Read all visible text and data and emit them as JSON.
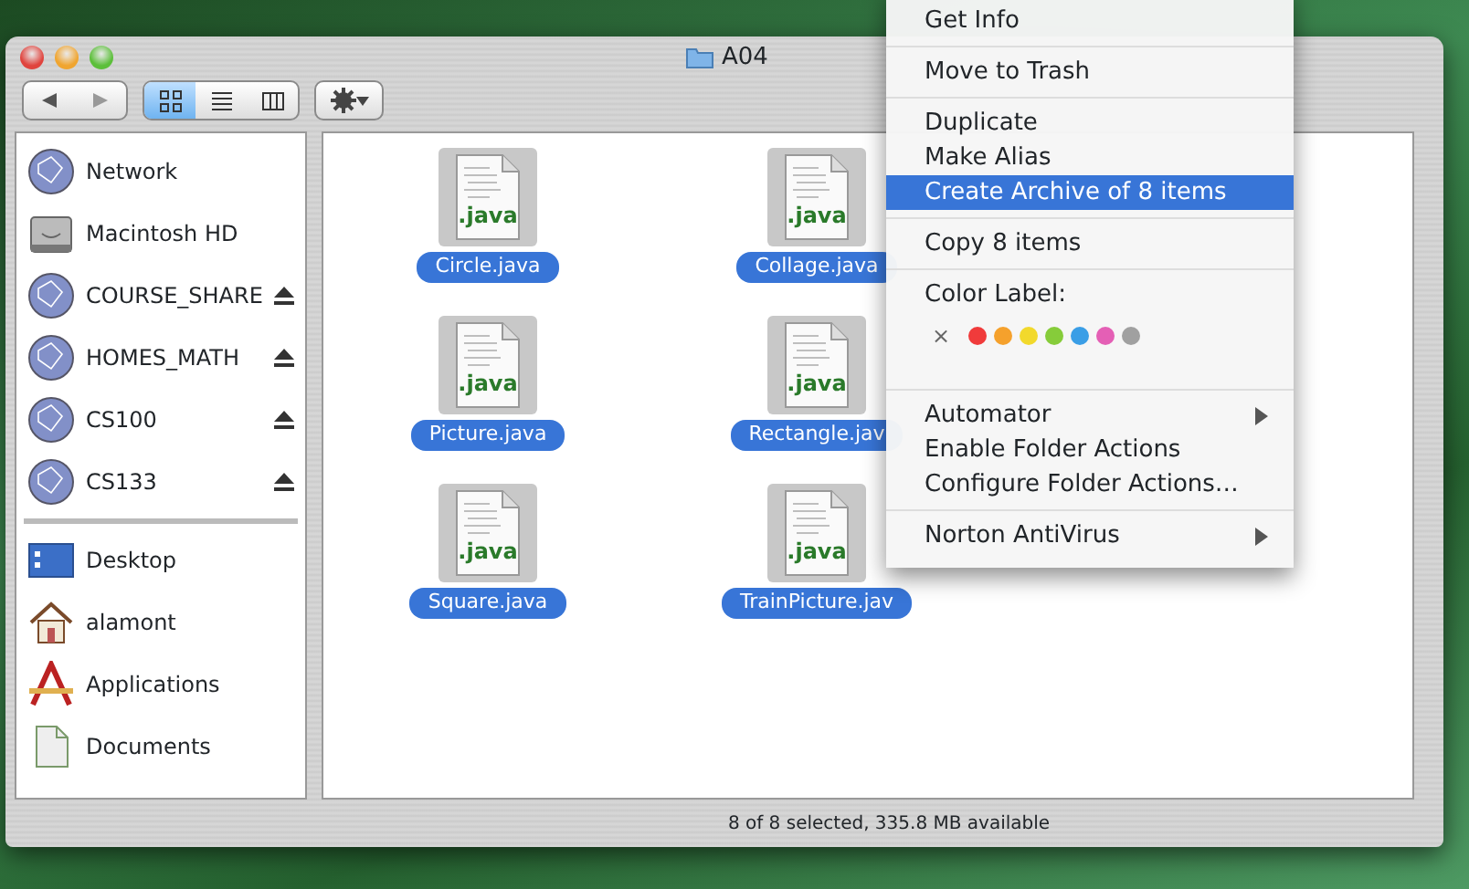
{
  "window": {
    "title": "A04"
  },
  "toolbar": {
    "views": [
      {
        "kind": "icons",
        "selected": true
      },
      {
        "kind": "list",
        "selected": false
      },
      {
        "kind": "columns",
        "selected": false
      }
    ]
  },
  "sidebar": {
    "devices": [
      {
        "label": "Network",
        "kind": "network",
        "eject": false
      },
      {
        "label": "Macintosh HD",
        "kind": "disk",
        "eject": false
      },
      {
        "label": "COURSE_SHARE",
        "kind": "share",
        "eject": true
      },
      {
        "label": "HOMES_MATH",
        "kind": "share",
        "eject": true
      },
      {
        "label": "CS100",
        "kind": "share",
        "eject": true
      },
      {
        "label": "CS133",
        "kind": "share",
        "eject": true
      }
    ],
    "places": [
      {
        "label": "Desktop",
        "kind": "desktop"
      },
      {
        "label": "alamont",
        "kind": "home"
      },
      {
        "label": "Applications",
        "kind": "apps"
      },
      {
        "label": "Documents",
        "kind": "docs"
      }
    ]
  },
  "files": [
    {
      "name": "Circle.java",
      "icon_text": ".java",
      "selected": true
    },
    {
      "name": "Collage.java",
      "icon_text": ".java",
      "selected": true
    },
    {
      "name": "Picture.java",
      "icon_text": ".java",
      "selected": true
    },
    {
      "name": "Rectangle.jav",
      "icon_text": ".java",
      "selected": true
    },
    {
      "name": "Square.java",
      "icon_text": ".java",
      "selected": true
    },
    {
      "name": "TrainPicture.jav",
      "icon_text": ".java",
      "selected": true
    }
  ],
  "status_bar": "8 of 8 selected, 335.8 MB available",
  "context_menu": {
    "groups": [
      [
        {
          "label": "Get Info",
          "highlighted": false,
          "submenu": false
        }
      ],
      [
        {
          "label": "Move to Trash",
          "highlighted": false,
          "submenu": false
        }
      ],
      [
        {
          "label": "Duplicate",
          "highlighted": false,
          "submenu": false
        },
        {
          "label": "Make Alias",
          "highlighted": false,
          "submenu": false
        },
        {
          "label": "Create Archive of 8 items",
          "highlighted": true,
          "submenu": false
        }
      ],
      [
        {
          "label": "Copy 8 items",
          "highlighted": false,
          "submenu": false
        }
      ],
      [
        {
          "label": "Color Label:",
          "kind": "color_label",
          "clear": "×",
          "colors": [
            {
              "color": "#f03b3b"
            },
            {
              "color": "#f5a12c"
            },
            {
              "color": "#f2d92c"
            },
            {
              "color": "#86cc3a"
            },
            {
              "color": "#3a9ee6"
            },
            {
              "color": "#e45fb5"
            },
            {
              "color": "#a0a0a0"
            }
          ]
        }
      ],
      [
        {
          "label": "Automator",
          "highlighted": false,
          "submenu": true
        },
        {
          "label": "Enable Folder Actions",
          "highlighted": false,
          "submenu": false
        },
        {
          "label": "Configure Folder Actions…",
          "highlighted": false,
          "submenu": false
        }
      ],
      [
        {
          "label": "Norton AntiVirus",
          "highlighted": false,
          "submenu": true
        }
      ]
    ]
  }
}
